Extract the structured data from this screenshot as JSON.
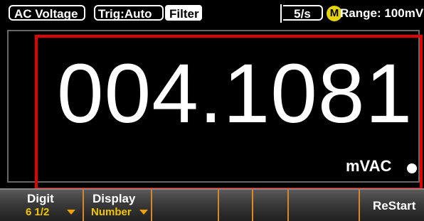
{
  "status": {
    "function": "AC Voltage",
    "trigger": "Trig:Auto",
    "filter": "Filter",
    "rate": "5/s",
    "mode_badge": "M",
    "range": "Range: 100mV"
  },
  "display": {
    "reading": "004.1081",
    "unit": "mVAC"
  },
  "softkeys": [
    {
      "label": "Digit",
      "value": "6 1/2"
    },
    {
      "label": "Display",
      "value": "Number"
    },
    {
      "label": "",
      "value": ""
    },
    {
      "label": "",
      "value": ""
    },
    {
      "label": "",
      "value": ""
    },
    {
      "label": "",
      "value": ""
    },
    {
      "label": "ReStart",
      "value": ""
    }
  ],
  "colors": {
    "highlight_border": "#e00000",
    "softkey_value": "#f0c400",
    "mode_badge": "#e6d400"
  },
  "icons": {
    "softkey_arrow": "chevron-down-icon",
    "status_dot": "status-dot-icon"
  }
}
